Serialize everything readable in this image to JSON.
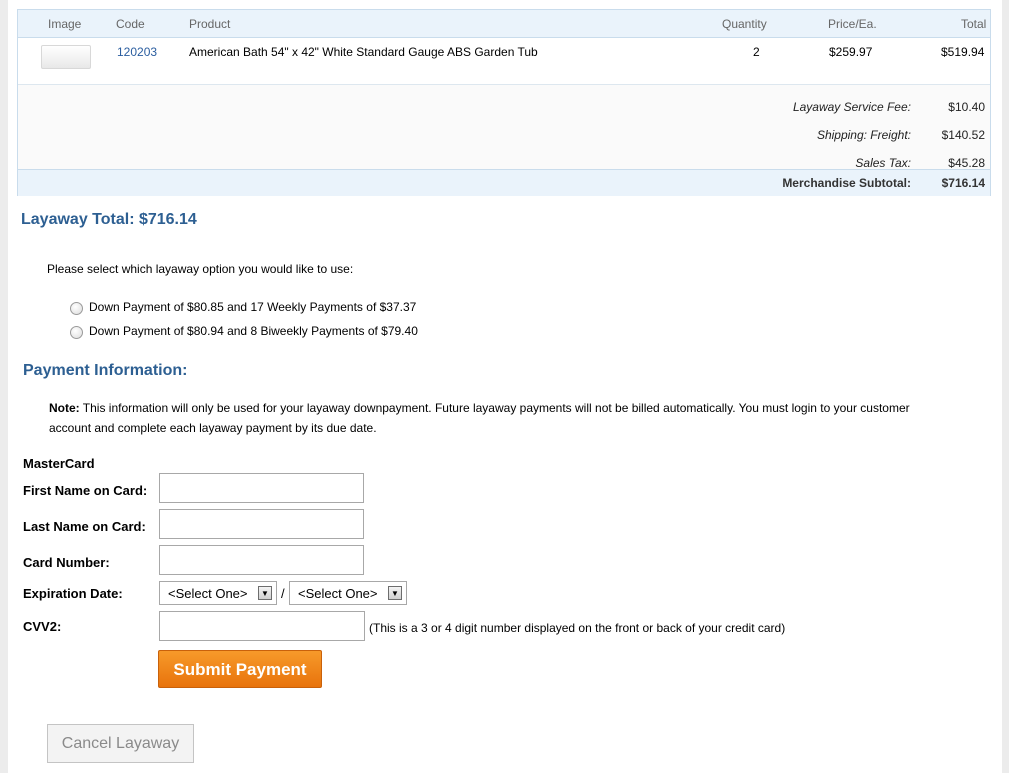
{
  "cart": {
    "headers": [
      "Image",
      "Code",
      "Product",
      "Quantity",
      "Price/Ea.",
      "Total"
    ],
    "item": {
      "code": "120203",
      "product": "American Bath 54\" x 42\" White Standard Gauge ABS Garden Tub",
      "quantity": "2",
      "price": "$259.97",
      "total": "$519.94"
    },
    "summary": [
      {
        "label": "Layaway Service Fee:",
        "value": "$10.40"
      },
      {
        "label": "Shipping: Freight:",
        "value": "$140.52"
      },
      {
        "label": "Sales Tax:",
        "value": "$45.28"
      }
    ],
    "subtotal": {
      "label": "Merchandise Subtotal:",
      "value": "$716.14"
    }
  },
  "layaway": {
    "total": "Layaway Total: $716.14",
    "prompt": "Please select which layaway option you would like to use:",
    "options": [
      "Down Payment of $80.85 and 17 Weekly Payments of $37.37",
      "Down Payment of $80.94 and 8 Biweekly Payments of $79.40"
    ]
  },
  "payment": {
    "heading": "Payment Information:",
    "note_label": "Note:",
    "note_text": " This information will only be used for your layaway downpayment. Future layaway payments will not be billed automatically. You must login to your customer account and complete each layaway payment by its due date.",
    "card_type": "MasterCard",
    "first_name_label": "First Name on Card:",
    "last_name_label": "Last Name on Card:",
    "card_number_label": "Card Number:",
    "expiration_label": "Expiration Date:",
    "exp_month": "<Select One>",
    "exp_year": "<Select One>",
    "exp_separator": "/",
    "cvv_label": "CVV2:",
    "cvv_hint": "(This is a 3 or 4 digit number displayed on the front or back of your credit card)",
    "submit_label": "Submit Payment"
  },
  "cancel_label": "Cancel Layaway"
}
